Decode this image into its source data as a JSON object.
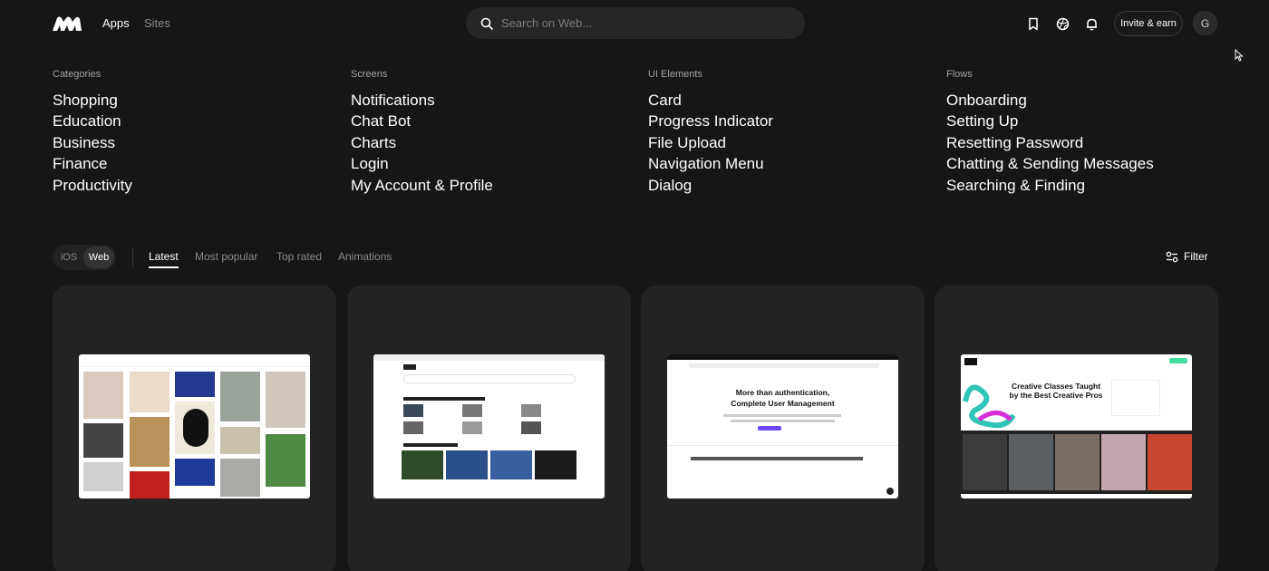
{
  "header": {
    "nav": [
      "Apps",
      "Sites"
    ],
    "search_placeholder": "Search on Web...",
    "invite_label": "Invite & earn",
    "avatar_initial": "G",
    "icons": [
      "logo-icon",
      "search-icon",
      "bookmark-icon",
      "globe-icon",
      "bell-icon",
      "cursor-icon"
    ]
  },
  "menu": {
    "columns": [
      {
        "heading": "Categories",
        "items": [
          "Shopping",
          "Education",
          "Business",
          "Finance",
          "Productivity"
        ]
      },
      {
        "heading": "Screens",
        "items": [
          "Notifications",
          "Chat Bot",
          "Charts",
          "Login",
          "My Account & Profile"
        ]
      },
      {
        "heading": "UI Elements",
        "items": [
          "Card",
          "Progress Indicator",
          "File Upload",
          "Navigation Menu",
          "Dialog"
        ]
      },
      {
        "heading": "Flows",
        "items": [
          "Onboarding",
          "Setting Up",
          "Resetting Password",
          "Chatting & Sending Messages",
          "Searching & Finding"
        ]
      }
    ]
  },
  "filters": {
    "platforms": [
      "iOS",
      "Web"
    ],
    "selected_platform": "Web",
    "tabs": [
      "Latest",
      "Most popular",
      "Top rated",
      "Animations"
    ],
    "active_tab": "Latest",
    "filter_label": "Filter"
  },
  "cards": {
    "card3": {
      "headline_1": "More than authentication,",
      "headline_2": "Complete User Management"
    },
    "card4": {
      "headline_1": "Creative Classes Taught",
      "headline_2": "by the Best Creative Pros"
    }
  },
  "colors": {
    "background": "#161616",
    "card": "#232323",
    "search_bg": "#262626",
    "text_primary": "#ffffff",
    "text_muted": "#8a8a8a"
  }
}
